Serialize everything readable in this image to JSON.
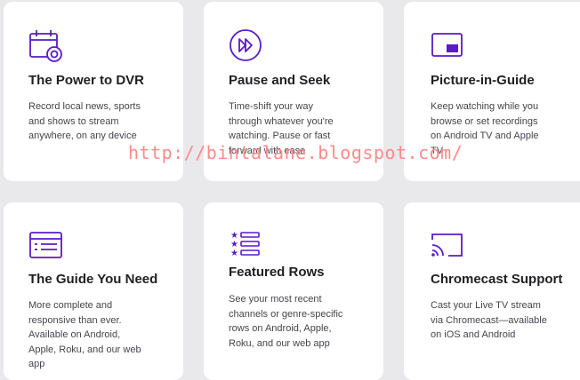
{
  "colors": {
    "accent": "#5a1ac8",
    "background": "#e9e9ec",
    "card": "#ffffff",
    "watermark": "#ff8a8a"
  },
  "cards": [
    {
      "icon": "calendar-dvr-icon",
      "title": "The Power to DVR",
      "lines": [
        "Record local news, sports",
        "and shows to stream",
        "anywhere, on any device"
      ]
    },
    {
      "icon": "fast-forward-icon",
      "title": "Pause and Seek",
      "lines": [
        "Time-shift your way",
        "through whatever you're",
        "watching. Pause or fast",
        "forward with ease"
      ]
    },
    {
      "icon": "picture-in-guide-icon",
      "title": "Picture-in-Guide",
      "lines": [
        "Keep watching while you",
        "browse or set recordings",
        "on Android TV and Apple",
        "TV"
      ]
    },
    {
      "icon": "guide-list-icon",
      "title": "The Guide You Need",
      "lines": [
        "More complete and",
        "responsive than ever.",
        "Available on Android,",
        "Apple, Roku, and our web",
        "app"
      ]
    },
    {
      "icon": "featured-rows-icon",
      "title": "Featured Rows",
      "lines": [
        "See your most recent",
        "channels or genre-specific",
        "rows on Android, Apple,",
        "Roku, and our web app"
      ]
    },
    {
      "icon": "chromecast-icon",
      "title": "Chromecast Support",
      "lines": [
        "Cast your Live TV stream",
        "via Chromecast—available",
        "on iOS and Android"
      ]
    }
  ],
  "watermark": "http://bintalane.blogspot.com/"
}
